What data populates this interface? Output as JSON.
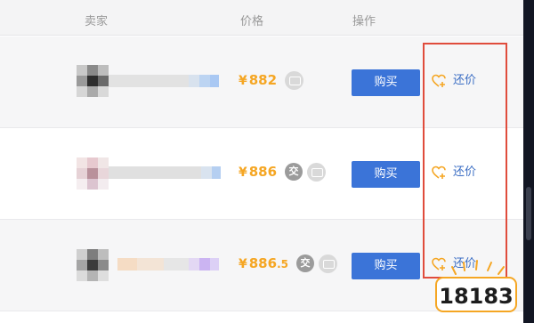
{
  "table": {
    "headers": {
      "seller": "卖家",
      "price": "价格",
      "actions": "操作"
    },
    "rows": [
      {
        "seller_name_visible": false,
        "price_symbol": "¥",
        "price_int": "882",
        "price_dec": "",
        "badges": [
          "card-icon"
        ],
        "buy_label": "购买",
        "bargain_label": "还价"
      },
      {
        "seller_name_visible": false,
        "price_symbol": "¥",
        "price_int": "886",
        "price_dec": "",
        "badges": [
          "交",
          "card-icon"
        ],
        "buy_label": "购买",
        "bargain_label": "还价"
      },
      {
        "seller_name_visible": false,
        "price_symbol": "¥",
        "price_int": "886",
        "price_dec": ".5",
        "badges": [
          "交",
          "card-icon"
        ],
        "buy_label": "购买",
        "bargain_label": "还价"
      }
    ]
  },
  "watermark": {
    "text": "18183"
  },
  "colors": {
    "price": "#f5a623",
    "buy_button": "#3b74d8",
    "bargain_text": "#3d6fc4",
    "highlight_box": "#e04c3c",
    "header_bg": "#f4f4f5"
  }
}
